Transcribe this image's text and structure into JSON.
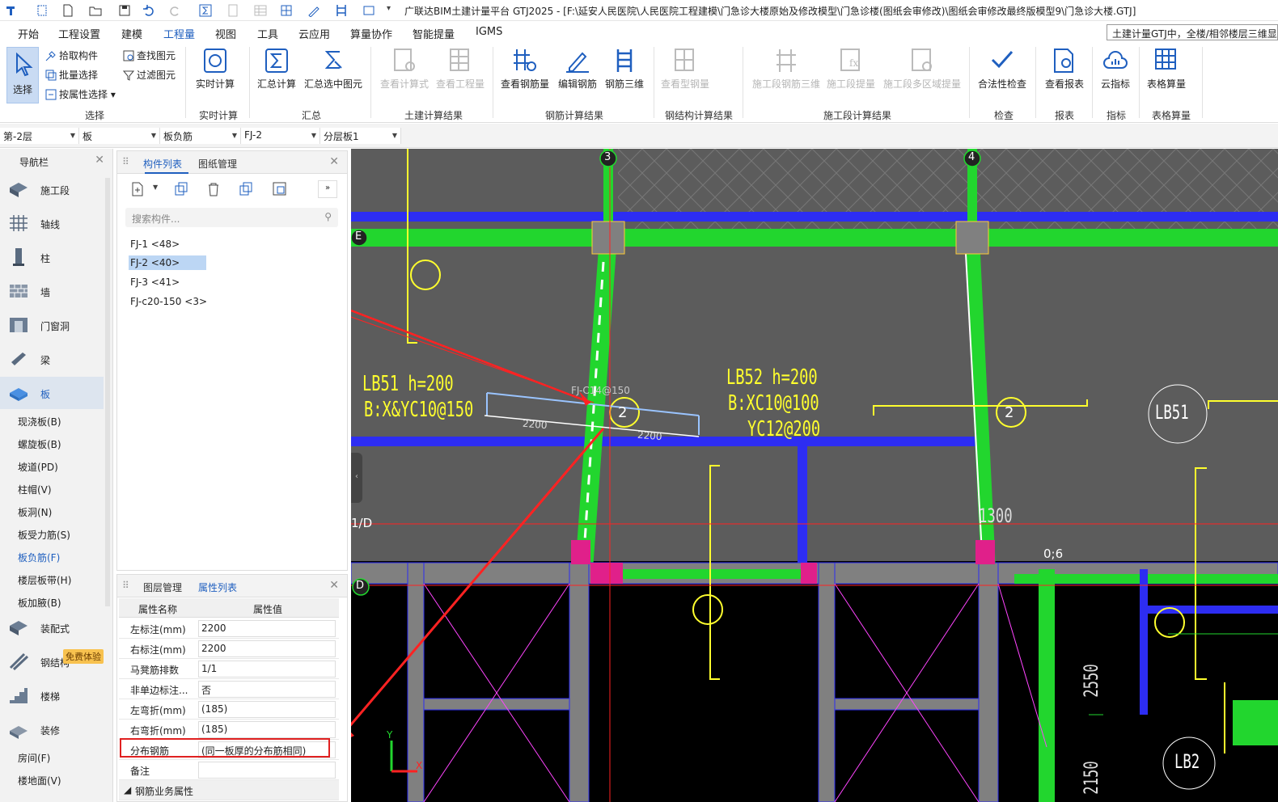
{
  "window": {
    "title": "广联达BIM土建计量平台 GTJ2025 - [F:\\延安人民医院\\人民医院工程建模\\门急诊大楼原始及修改模型\\门急诊楼(图纸会审修改)\\图纸会审修改最终版模型9\\门急诊大楼.GTJ]"
  },
  "menu": {
    "items": [
      "开始",
      "工程设置",
      "建模",
      "工程量",
      "视图",
      "工具",
      "云应用",
      "算量协作",
      "智能提量",
      "IGMS"
    ],
    "active": "工程量",
    "hint": "土建计量GTJ中，全楼/相邻楼层三维显"
  },
  "ribbon": {
    "select": "选择",
    "pick": "拾取构件",
    "batch": "批量选择",
    "byattr": "按属性选择",
    "find": "查找图元",
    "filter": "过滤图元",
    "realtime": "实时计算",
    "sum_calc": "汇总计算",
    "sum_sel": "汇总选中图元",
    "view_formula": "查看计算式",
    "view_qty": "查看工程量",
    "view_rebar": "查看钢筋量",
    "edit_rebar": "编辑钢筋",
    "rebar3d": "钢筋三维",
    "view_steel": "查看型钢量",
    "stage_rebar3d": "施工段钢筋三维",
    "stage_qty": "施工段提量",
    "stage_multi": "施工段多区域提量",
    "legal_check": "合法性检查",
    "view_report": "查看报表",
    "cloud_index": "云指标",
    "table_calc": "表格算量",
    "groups": {
      "select": "选择",
      "realtime": "实时计算",
      "sum": "汇总",
      "civil": "土建计算结果",
      "rebar": "钢筋计算结果",
      "steel": "钢结构计算结果",
      "stage": "施工段计算结果",
      "check": "检查",
      "report": "报表",
      "index": "指标",
      "table": "表格算量"
    }
  },
  "filters": [
    "第-2层",
    "板",
    "板负筋",
    "FJ-2",
    "分层板1"
  ],
  "nav": {
    "title": "导航栏",
    "items": [
      "施工段",
      "轴线",
      "柱",
      "墙",
      "门窗洞",
      "梁",
      "板"
    ],
    "subs": [
      "现浇板(B)",
      "螺旋板(B)",
      "坡道(PD)",
      "柱帽(V)",
      "板洞(N)",
      "板受力筋(S)",
      "板负筋(F)",
      "楼层板带(H)",
      "板加腋(B)"
    ],
    "items2": [
      "装配式",
      "钢结构",
      "楼梯",
      "装修"
    ],
    "subs2": [
      "房间(F)",
      "楼地面(V)"
    ],
    "badge": "免费体验"
  },
  "components": {
    "tabs": [
      "构件列表",
      "图纸管理"
    ],
    "search_placeholder": "搜索构件...",
    "items": [
      "FJ-1 <48>",
      "FJ-2 <40>",
      "FJ-3 <41>",
      "FJ-c20-150 <3>"
    ],
    "selected": "FJ-2 <40>"
  },
  "props": {
    "tabs": [
      "图层管理",
      "属性列表"
    ],
    "head": [
      "属性名称",
      "属性值"
    ],
    "rows": [
      {
        "n": "左标注(mm)",
        "v": "2200"
      },
      {
        "n": "右标注(mm)",
        "v": "2200"
      },
      {
        "n": "马凳筋排数",
        "v": "1/1"
      },
      {
        "n": "非单边标注...",
        "v": "否"
      },
      {
        "n": "左弯折(mm)",
        "v": "(185)"
      },
      {
        "n": "右弯折(mm)",
        "v": "(185)"
      },
      {
        "n": "分布钢筋",
        "v": "(同一板厚的分布筋相同)"
      },
      {
        "n": "备注",
        "v": ""
      }
    ],
    "group": "钢筋业务属性"
  },
  "cad": {
    "axis_labels": [
      "3",
      "4",
      "E",
      "1/D",
      "D"
    ],
    "lb51": [
      "LB51 h=200",
      "B:X&YC10@150"
    ],
    "lb52": [
      "LB52 h=200",
      "B:XC10@100",
      "YC12@200"
    ],
    "rebar_label": "FJ-C14@150",
    "dims": [
      "2200",
      "2200",
      "1300",
      "2550",
      "2150",
      "0;6"
    ],
    "circles": [
      "2",
      "2",
      "LB51",
      "LB2"
    ],
    "xy": [
      "Y",
      "X"
    ]
  },
  "colors": {
    "accent": "#1f5fbf",
    "wall_green": "#22d62e",
    "beam_blue": "#2d2df2",
    "grid_yellow": "#ffff2e",
    "red": "#ff2222"
  }
}
